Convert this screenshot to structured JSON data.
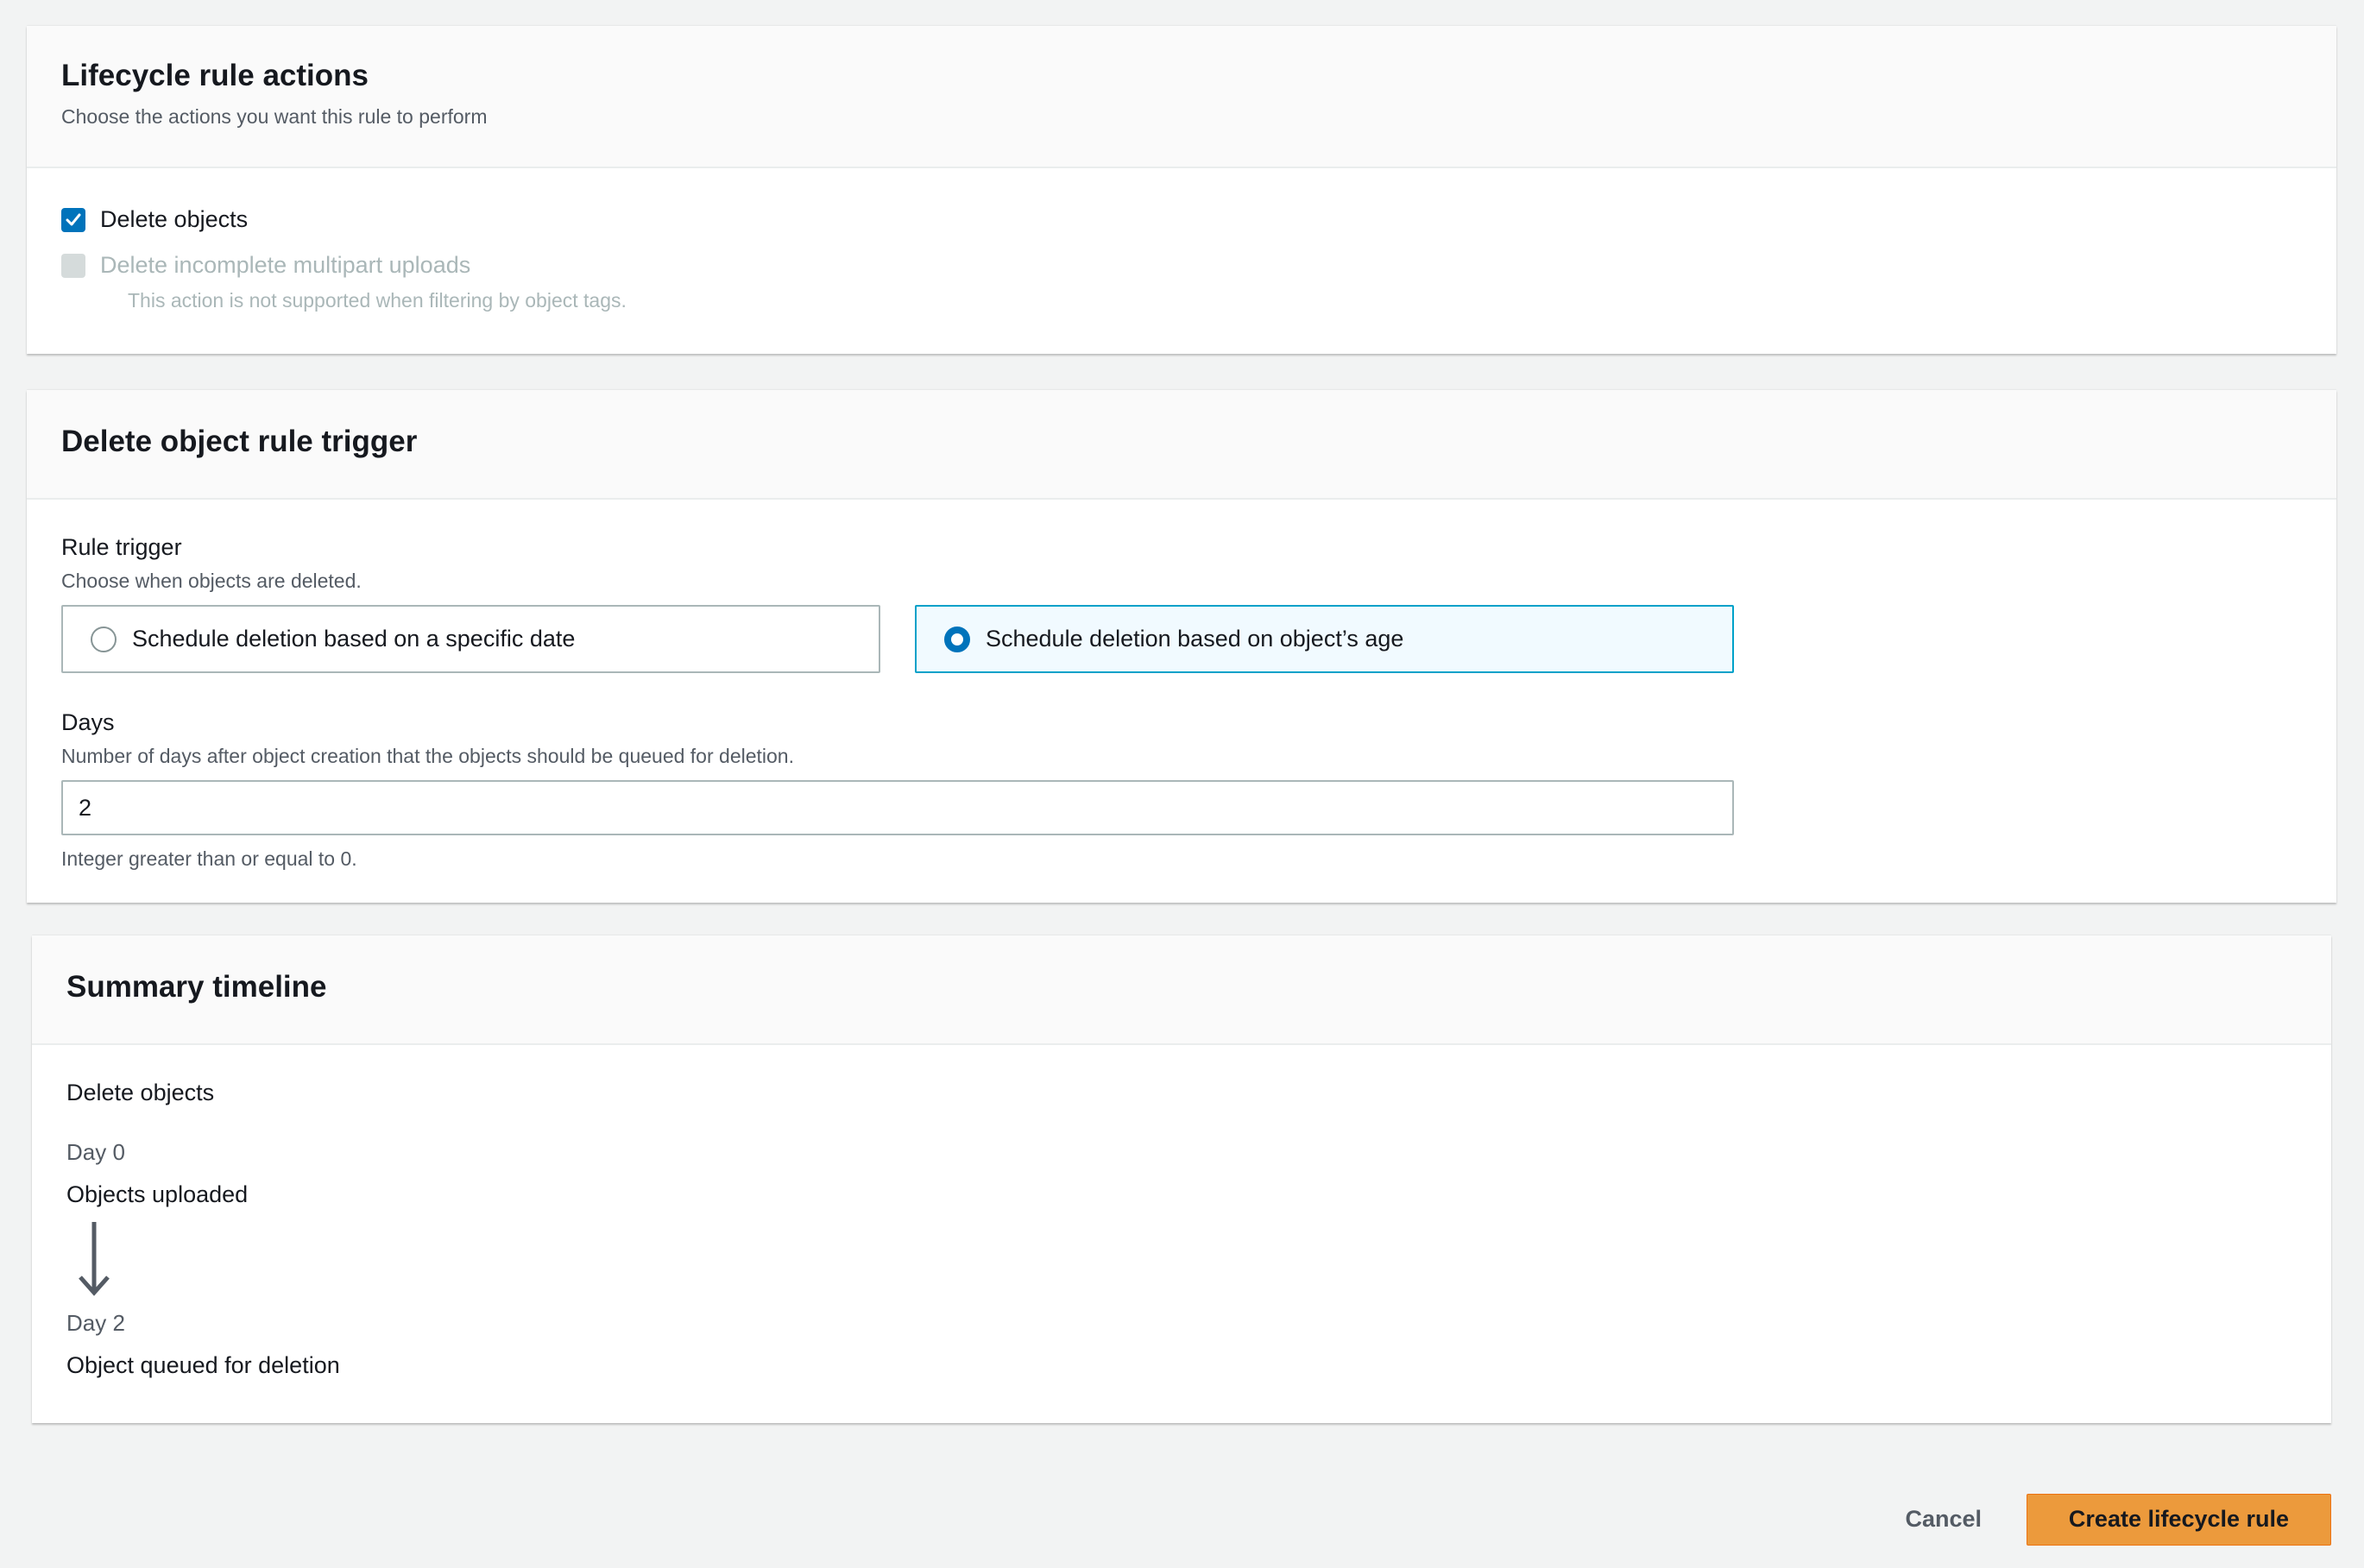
{
  "actions_panel": {
    "title": "Lifecycle rule actions",
    "description": "Choose the actions you want this rule to perform",
    "options": [
      {
        "label": "Delete objects",
        "checked": true,
        "disabled": false
      },
      {
        "label": "Delete incomplete multipart uploads",
        "checked": false,
        "disabled": true,
        "hint": "This action is not supported when filtering by object tags."
      }
    ]
  },
  "trigger_panel": {
    "title": "Delete object rule trigger",
    "rule_trigger": {
      "label": "Rule trigger",
      "description": "Choose when objects are deleted.",
      "options": [
        {
          "label": "Schedule deletion based on a specific date",
          "selected": false
        },
        {
          "label": "Schedule deletion based on object’s age",
          "selected": true
        }
      ]
    },
    "days": {
      "label": "Days",
      "description": "Number of days after object creation that the objects should be queued for deletion.",
      "value": "2",
      "hint": "Integer greater than or equal to 0."
    }
  },
  "timeline_panel": {
    "title": "Summary timeline",
    "section": "Delete objects",
    "steps": [
      {
        "day": "Day 0",
        "event": "Objects uploaded"
      },
      {
        "day": "Day 2",
        "event": "Object queued for deletion"
      }
    ]
  },
  "footer": {
    "cancel_label": "Cancel",
    "create_label": "Create lifecycle rule"
  },
  "colors": {
    "primary_button": "#ec9a3c",
    "checkbox_checked": "#0073bb",
    "selected_tile_border": "#00a1c9"
  }
}
